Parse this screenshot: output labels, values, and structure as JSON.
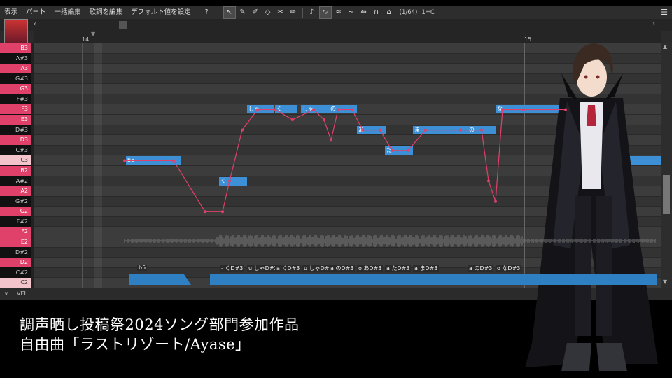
{
  "menu": [
    "表示",
    "パート",
    "一括編集",
    "歌詞を編集",
    "デフォルト値を設定",
    "?"
  ],
  "toolbar": {
    "position": "(1/64)",
    "key": "1=C"
  },
  "ruler": {
    "bars": [
      "14",
      "15"
    ]
  },
  "piano_keys": [
    {
      "label": "B3",
      "black": false
    },
    {
      "label": "A#3",
      "black": true
    },
    {
      "label": "A3",
      "black": false
    },
    {
      "label": "G#3",
      "black": true
    },
    {
      "label": "G3",
      "black": false
    },
    {
      "label": "F#3",
      "black": true
    },
    {
      "label": "F3",
      "black": false
    },
    {
      "label": "E3",
      "black": false
    },
    {
      "label": "D#3",
      "black": true
    },
    {
      "label": "D3",
      "black": false
    },
    {
      "label": "C#3",
      "black": true
    },
    {
      "label": "C3",
      "black": false,
      "highlight": true
    },
    {
      "label": "B2",
      "black": false
    },
    {
      "label": "A#2",
      "black": true
    },
    {
      "label": "A2",
      "black": false
    },
    {
      "label": "G#2",
      "black": true
    },
    {
      "label": "G2",
      "black": false
    },
    {
      "label": "F#2",
      "black": true
    },
    {
      "label": "F2",
      "black": false
    },
    {
      "label": "E2",
      "black": false
    },
    {
      "label": "D#2",
      "black": true
    },
    {
      "label": "D2",
      "black": false
    },
    {
      "label": "C#2",
      "black": true
    },
    {
      "label": "C2",
      "black": false,
      "highlight": true
    }
  ],
  "notes": [
    {
      "lyric": "b5",
      "pitch": "C3"
    },
    {
      "lyric": "く",
      "pitch": "A#2"
    },
    {
      "lyric": "しゃ",
      "pitch": "F3"
    },
    {
      "lyric": "く",
      "pitch": "F3"
    },
    {
      "lyric": "しゃ",
      "pitch": "F3"
    },
    {
      "lyric": "の",
      "pitch": "F3"
    },
    {
      "lyric": "あ",
      "pitch": "D#3"
    },
    {
      "lyric": "た",
      "pitch": "C#3"
    },
    {
      "lyric": "ま",
      "pitch": "D#3"
    },
    {
      "lyric": "の",
      "pitch": "D#3"
    },
    {
      "lyric": "な",
      "pitch": "F3"
    }
  ],
  "phonemes": [
    "b5",
    "- くD#3",
    "u しゃD#3",
    "a くD#3",
    "u しゃD#3",
    "a のD#3",
    "o あD#3",
    "a たD#3",
    "a まD#3",
    "a のD#3",
    "o なD#3"
  ],
  "bottom": {
    "label": "VEL"
  },
  "caption": {
    "line1": "調声晒し投稿祭2024ソング部門参加作品",
    "line2": "自由曲「ラストリゾート/Ayase」"
  },
  "colors": {
    "note": "#3d8fd6",
    "pitch_curve": "#e0416a",
    "key_accent": "#e0416a"
  }
}
